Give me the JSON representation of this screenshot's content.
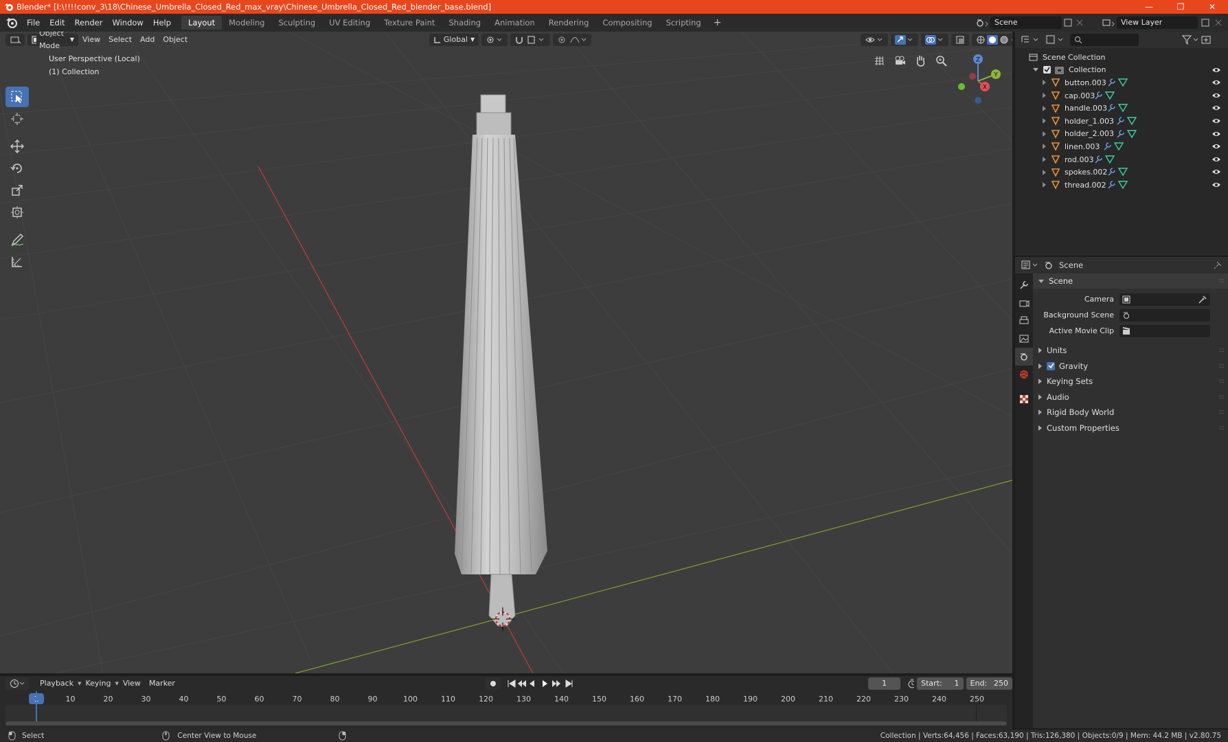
{
  "window": {
    "title": "Blender* [I:\\!!!!conv_3\\18\\Chinese_Umbrella_Closed_Red_max_vray\\Chinese_Umbrella_Closed_Red_blender_base.blend]"
  },
  "menu": {
    "items": [
      "File",
      "Edit",
      "Render",
      "Window",
      "Help"
    ],
    "workspaces": [
      "Layout",
      "Modeling",
      "Sculpting",
      "UV Editing",
      "Texture Paint",
      "Shading",
      "Animation",
      "Rendering",
      "Compositing",
      "Scripting"
    ],
    "active_workspace": "Layout",
    "add_workspace": "+",
    "scene": "Scene",
    "view_layer": "View Layer"
  },
  "viewport": {
    "mode": "Object Mode",
    "menus": [
      "View",
      "Select",
      "Add",
      "Object"
    ],
    "orientation": "Global",
    "perspective_label": "User Perspective (Local)",
    "collection_label": "(1) Collection",
    "gizmo": {
      "z": "Z",
      "y": "Y",
      "x": "X"
    },
    "colors": {
      "background": "#3d3d3d",
      "x_axis": "#c33c3c",
      "y_axis": "#7fa12a",
      "active_tool": "#4772b3"
    }
  },
  "timeline": {
    "menus": [
      "Playback",
      "Keying",
      "View",
      "Marker"
    ],
    "current_frame": "1",
    "start_label": "Start:",
    "start": "1",
    "end_label": "End:",
    "end": "250",
    "ruler": [
      "1",
      "10",
      "20",
      "30",
      "40",
      "50",
      "60",
      "70",
      "80",
      "90",
      "100",
      "110",
      "120",
      "130",
      "140",
      "150",
      "160",
      "170",
      "180",
      "190",
      "200",
      "210",
      "220",
      "230",
      "240",
      "250"
    ]
  },
  "statusbar": {
    "select": "Select",
    "center_view": "Center View to Mouse",
    "stats": "Collection | Verts:64,456 | Faces:63,190 | Tris:126,380 | Objects:0/9 | Mem: 44.2 MB | v2.80.75"
  },
  "outliner": {
    "root": "Scene Collection",
    "collection": "Collection",
    "objects": [
      "button.003",
      "cap.003",
      "handle.003",
      "holder_1.003",
      "holder_2.003",
      "linen.003",
      "rod.003",
      "spokes.002",
      "thread.002"
    ]
  },
  "properties": {
    "context": "Scene",
    "panel": "Scene",
    "camera_label": "Camera",
    "background_scene_label": "Background Scene",
    "active_movie_clip_label": "Active Movie Clip",
    "subpanels": {
      "units": "Units",
      "gravity": "Gravity",
      "keying_sets": "Keying Sets",
      "audio": "Audio",
      "rigid_body_world": "Rigid Body World",
      "custom_properties": "Custom Properties"
    },
    "gravity_enabled": true
  }
}
